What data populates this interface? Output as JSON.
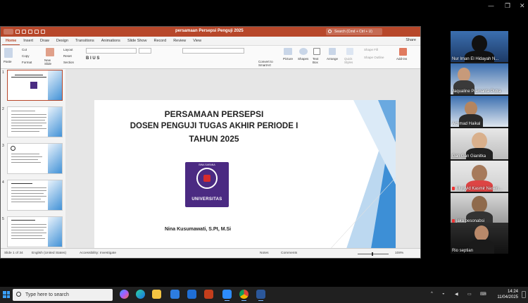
{
  "ppt": {
    "doc_title": "persamaan Persepsi Penguji 2025",
    "search_placeholder": "Search (Cmd + Ctrl + U)",
    "tabs": [
      "Home",
      "Insert",
      "Draw",
      "Design",
      "Transitions",
      "Animations",
      "Slide Show",
      "Record",
      "Review",
      "View"
    ],
    "share": "Share",
    "ribbon": {
      "paste": "Paste",
      "cut": "Cut",
      "copy": "Copy",
      "format": "Format",
      "new_slide": "New Slide",
      "layout": "Layout",
      "reset": "Reset",
      "section": "Section",
      "convert": "Convert to SmartArt",
      "picture": "Picture",
      "shapes": "Shapes",
      "textbox": "Text Box",
      "arrange": "Arrange",
      "quick_styles": "Quick Styles",
      "shape_fill": "Shape Fill",
      "shape_outline": "Shape Outline",
      "addins": "Add-ins"
    },
    "thumb_numbers": [
      "1",
      "2",
      "3",
      "4",
      "5"
    ],
    "slide": {
      "line1": "PERSAMAAN PERSEPSI",
      "line2": "DOSEN PENGUJI TUGAS AKHIR PERIODE I",
      "line3": "TAHUN 2025",
      "logo_top": "BINA SARANA",
      "logo_bottom": "UNIVERSITAS",
      "author": "Nina Kusumawati, S.Pt, M.Si"
    },
    "status": {
      "slide_of": "Slide 1 of 34",
      "language": "English (United States)",
      "accessibility": "Accessibility: Investigate",
      "notes": "Notes",
      "comments": "Comments",
      "zoom": "108%"
    }
  },
  "participants": [
    {
      "name": "Nur Iman El Hidayah N...",
      "muted": false
    },
    {
      "name": "Jaqualine Pramanta Putra",
      "muted": false
    },
    {
      "name": "Achmad Haikal",
      "muted": false
    },
    {
      "name": "Gan Gan Gianitka",
      "muted": false
    },
    {
      "name": "Murjiyid Kasmir Naseri...",
      "muted": true
    },
    {
      "name": "jaka.pesonabsi",
      "muted": true
    },
    {
      "name": "Rio septian",
      "muted": false
    }
  ],
  "taskbar": {
    "search_placeholder": "Type here to search",
    "time": "14:24",
    "date": "11/04/2025"
  },
  "colors": {
    "ppt_accent": "#b7472a",
    "logo_purple": "#4b2a82",
    "slide_blue": "#3d8fd6"
  }
}
